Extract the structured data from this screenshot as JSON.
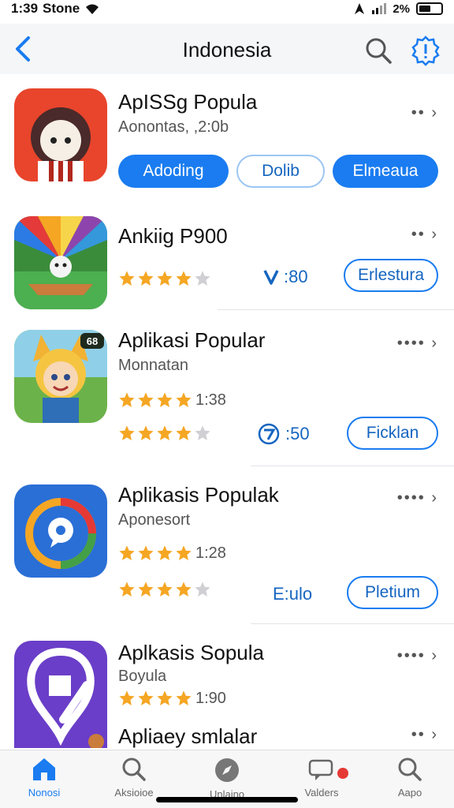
{
  "status_bar": {
    "time": "1:39",
    "carrier": "Stone",
    "battery": "2%"
  },
  "nav": {
    "title": "Indonesia"
  },
  "apps": [
    {
      "title": "ApISSg Popula",
      "subtitle": "Aonontas, ,2:0b",
      "more": "•• ›",
      "buttons": [
        "Adoding",
        "Dolib",
        "Elmeaua"
      ]
    },
    {
      "title": "Ankiig P900",
      "stars": 4,
      "more": "•• ›",
      "meta_value": ":80",
      "button": "Erlestura"
    },
    {
      "title": "Aplikasi Popular",
      "subtitle": "Monnatan",
      "rating_1_stars": 4,
      "rating_1_value": "1:38",
      "rating_2_stars": 4,
      "meta_value": ":50",
      "more": "•••• ›",
      "button": "Ficklan",
      "badge": "68"
    },
    {
      "title": "Aplikasis Populak",
      "subtitle": "Aponesort",
      "rating_1_stars": 4,
      "rating_1_value": "1:28",
      "rating_2_stars": 4,
      "meta_value": "E:ulo",
      "more": "•••• ›",
      "button": "Pletium"
    },
    {
      "title": "Aplkasis Sopula",
      "subtitle": "Boyula",
      "rating_1_stars": 4,
      "rating_1_value": "1:90",
      "more": "•••• ›",
      "more_2": "•• ›",
      "title_2": "Apliaey smlalar"
    }
  ],
  "tabs": [
    {
      "label": "Nonosi",
      "icon": "home-icon"
    },
    {
      "label": "Aksioioe",
      "icon": "search-icon"
    },
    {
      "label": "Unlaino",
      "icon": "compass-icon"
    },
    {
      "label": "Valders",
      "icon": "message-icon"
    },
    {
      "label": "Aapo",
      "icon": "search-icon"
    }
  ],
  "colors": {
    "accent": "#1a7cf0",
    "star": "#f5a623",
    "nav_bg": "#f5f6f8"
  }
}
